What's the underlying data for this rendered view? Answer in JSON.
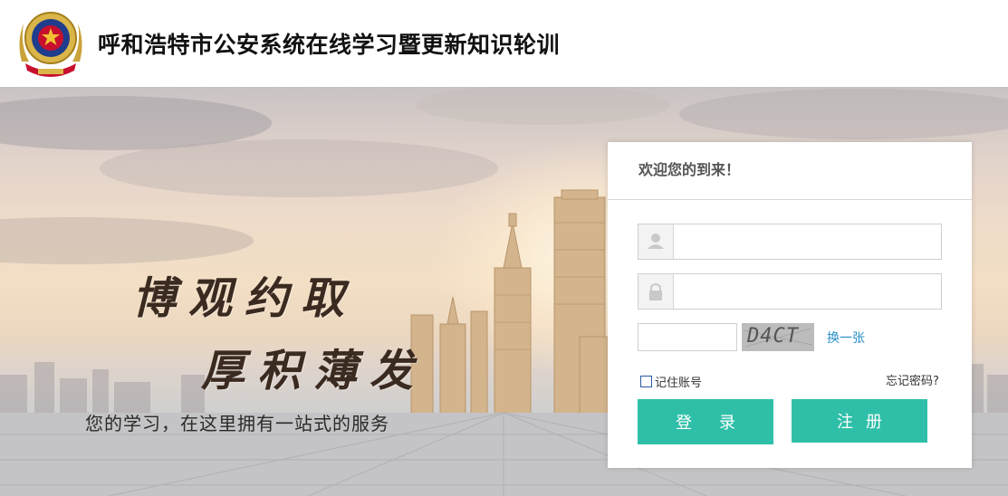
{
  "header": {
    "title": "呼和浩特市公安系统在线学习暨更新知识轮训",
    "logo_icon": "police-emblem-icon"
  },
  "banner": {
    "slogan_line1": "博观约取",
    "slogan_line2": "厚积薄发",
    "tagline": "您的学习，在这里拥有一站式的服务"
  },
  "login": {
    "welcome": "欢迎您的到来！",
    "username": {
      "value": "",
      "icon": "user-icon"
    },
    "password": {
      "value": "",
      "icon": "lock-icon"
    },
    "captcha_input": {
      "value": ""
    },
    "captcha_code": "D4CT",
    "refresh_label": "换一张",
    "remember_label": "记住账号",
    "forgot_label": "忘记密码?",
    "login_label": "登录",
    "register_label": "注册"
  },
  "colors": {
    "accent": "#2fbfa8",
    "link": "#2a8fc8"
  }
}
